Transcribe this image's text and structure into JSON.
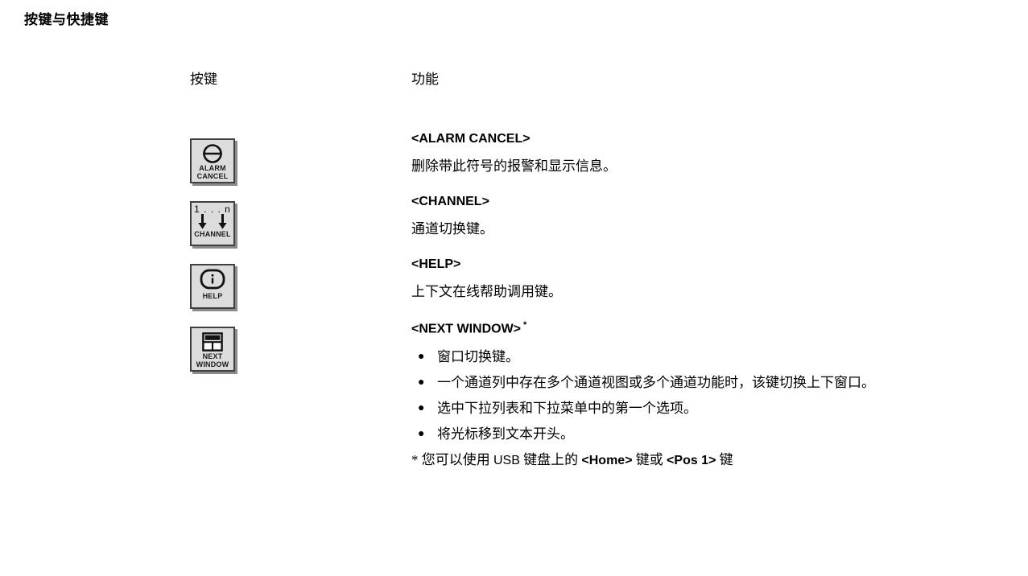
{
  "page": {
    "title": "按键与快捷键"
  },
  "table": {
    "headers": {
      "key": "按键",
      "function": "功能"
    },
    "rows": [
      {
        "key_icon": "alarm-cancel-key",
        "keycap_caption_line1": "ALARM",
        "keycap_caption_line2": "CANCEL",
        "title": "<ALARM CANCEL>",
        "description": "删除带此符号的报警和显示信息。"
      },
      {
        "key_icon": "channel-key",
        "keycap_top_label": "1 . . . n",
        "keycap_caption_line1": "CHANNEL",
        "title": "<CHANNEL>",
        "description": "通道切换键。"
      },
      {
        "key_icon": "help-key",
        "keycap_caption_line1": "HELP",
        "title": "<HELP>",
        "description": "上下文在线帮助调用键。"
      },
      {
        "key_icon": "next-window-key",
        "keycap_caption_line1": "NEXT",
        "keycap_caption_line2": "WINDOW",
        "title": "<NEXT WINDOW>",
        "title_footnote_marker": "*",
        "bullets": [
          "窗口切换键。",
          "一个通道列中存在多个通道视图或多个通道功能时，该键切换上下窗口。",
          "选中下拉列表和下拉菜单中的第一个选项。",
          "将光标移到文本开头。"
        ],
        "footnote": {
          "marker": "*",
          "text_before": "您可以使用",
          "usb": "USB",
          "text_mid1": "键盘上的",
          "key1": "<Home>",
          "text_mid2": "键或",
          "key2": "<Pos 1>",
          "text_after": "键"
        }
      }
    ]
  },
  "colors": {
    "keycap_face": "#dcdcdc",
    "keycap_border": "#404040",
    "keycap_shadow": "#8b8b8b",
    "text": "#000000",
    "page_background": "#ffffff"
  }
}
